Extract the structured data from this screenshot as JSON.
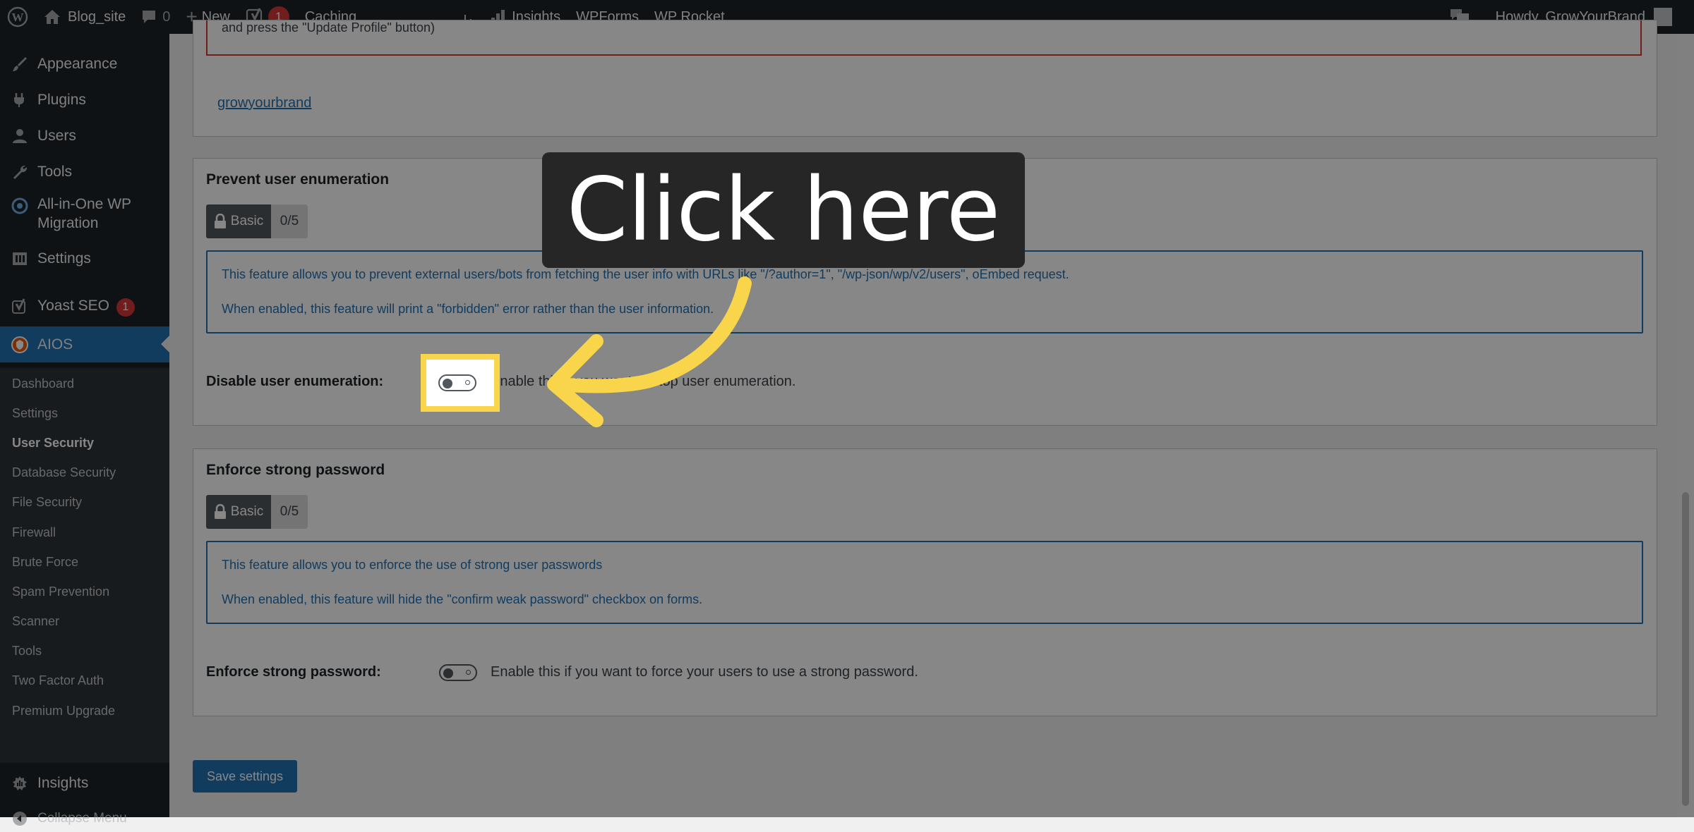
{
  "adminbar": {
    "site_name": "Blog_site",
    "comments_count": "0",
    "new_label": "New",
    "yoast_count": "1",
    "caching_label": "Caching",
    "insights_label": "Insights",
    "wpforms_label": "WPForms",
    "wprocket_label": "WP Rocket",
    "howdy": "Howdy, GrowYourBrand"
  },
  "sidebar": {
    "items": [
      {
        "label": "Appearance",
        "icon": "paintbrush-icon"
      },
      {
        "label": "Plugins",
        "icon": "plugin-icon"
      },
      {
        "label": "Users",
        "icon": "users-icon"
      },
      {
        "label": "Tools",
        "icon": "wrench-icon"
      },
      {
        "label": "All-in-One WP",
        "label2": "Migration",
        "icon": "migration-icon"
      },
      {
        "label": "Settings",
        "icon": "settings-icon"
      },
      {
        "label": "Yoast SEO",
        "icon": "yoast-icon",
        "badge": "1"
      },
      {
        "label": "AIOS",
        "icon": "aios-icon"
      }
    ],
    "submenu": [
      "Dashboard",
      "Settings",
      "User Security",
      "Database Security",
      "File Security",
      "Firewall",
      "Brute Force",
      "Spam Prevention",
      "Scanner",
      "Tools",
      "Two Factor Auth",
      "Premium Upgrade"
    ],
    "current_submenu": "User Security",
    "bottom": [
      {
        "label": "Insights",
        "icon": "insights-icon"
      },
      {
        "label": "Collapse Menu",
        "icon": "collapse-icon"
      }
    ]
  },
  "top_panel": {
    "cut_text": "and press the \"Update Profile\" button)",
    "user_link": "growyourbrand"
  },
  "enumeration_panel": {
    "title": "Prevent user enumeration",
    "badge_label": "Basic",
    "score": "0/5",
    "info_line1": "This feature allows you to prevent external users/bots from fetching the user info with URLs like \"/?author=1\", \"/wp-json/wp/v2/users\", oEmbed request.",
    "info_line2": "When enabled, this feature will print a \"forbidden\" error rather than the user information.",
    "field_label": "Disable user enumeration:",
    "field_desc": "Enable this if you want to stop user enumeration.",
    "enabled": false
  },
  "password_panel": {
    "title": "Enforce strong password",
    "badge_label": "Basic",
    "score": "0/5",
    "info_line1": "This feature allows you to enforce the use of strong user passwords",
    "info_line2": "When enabled, this feature will hide the \"confirm weak password\" checkbox on forms.",
    "field_label": "Enforce strong password:",
    "field_desc": "Enable this if you want to force your users to use a strong password.",
    "enabled": false
  },
  "save_button": "Save settings",
  "overlay": {
    "callout_text": "Click here",
    "highlight_color": "#f8d54a"
  },
  "colors": {
    "admin_dark": "#1d2327",
    "accent_blue": "#2271b1",
    "badge_red": "#d63638"
  }
}
